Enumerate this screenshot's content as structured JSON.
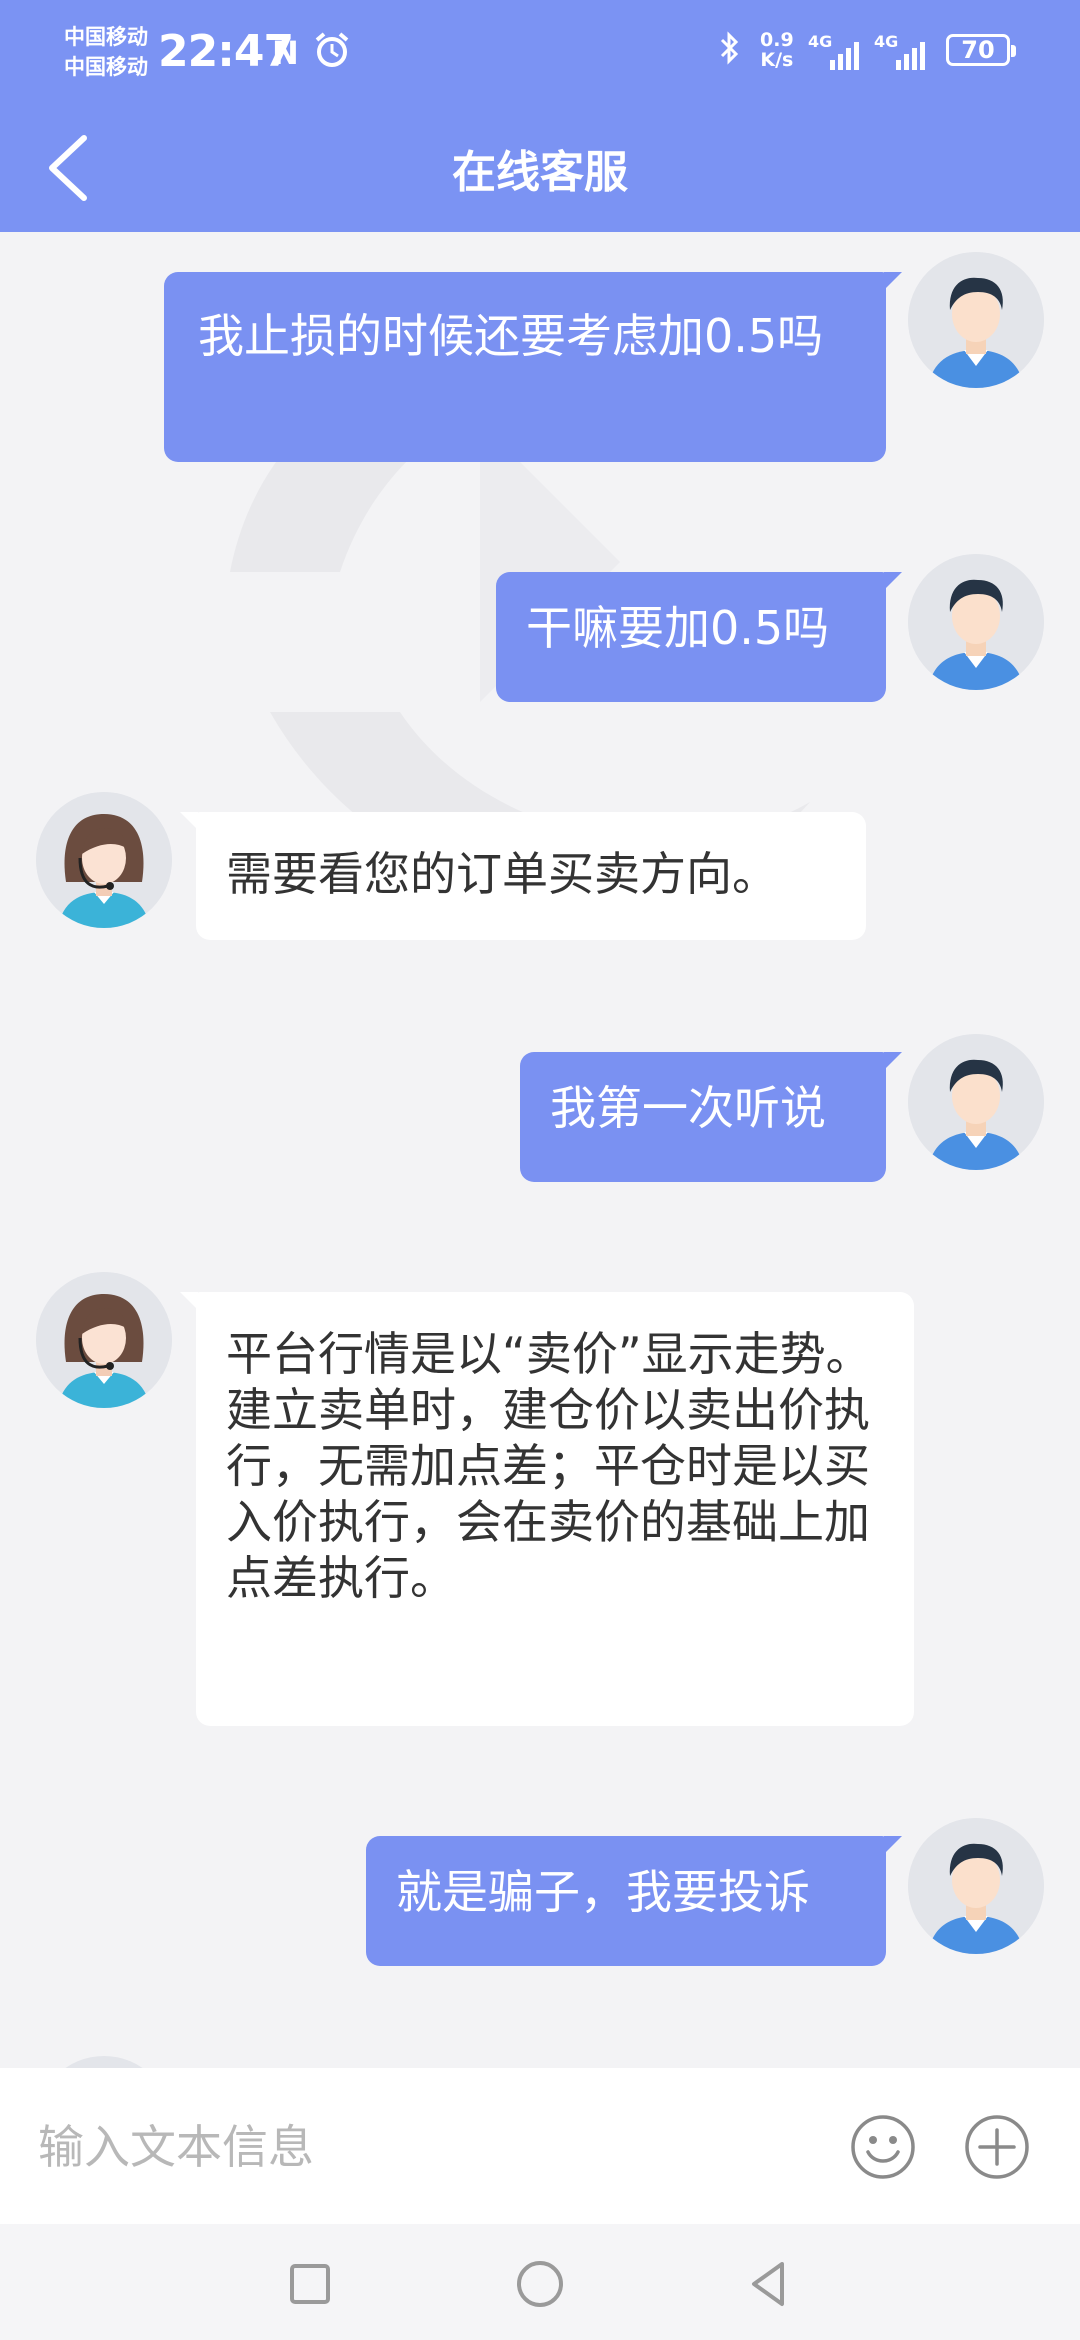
{
  "status_bar": {
    "carrier_1": "中国移动",
    "carrier_2": "中国移动",
    "time": "22:47",
    "nfc": "N",
    "net_speed_value": "0.9",
    "net_speed_unit": "K/s",
    "sim1_network": "4G",
    "sim2_network": "4G",
    "battery": "70"
  },
  "header": {
    "title": "在线客服"
  },
  "messages": [
    {
      "from": "user",
      "text": "我止损的时候还要考虑加0.5吗"
    },
    {
      "from": "user",
      "text": "干嘛要加0.5吗"
    },
    {
      "from": "agent",
      "text": "需要看您的订单买卖方向。"
    },
    {
      "from": "user",
      "text": "我第一次听说"
    },
    {
      "from": "agent",
      "text": "平台行情是以“卖价”显示走势。建立卖单时，建仓价以卖出价执行，无需加点差；平仓时是以买入价执行，会在卖价的基础上加点差执行。"
    },
    {
      "from": "user",
      "text": "就是骗子，我要投诉"
    }
  ],
  "input": {
    "placeholder": "输入文本信息",
    "value": ""
  },
  "icons": {
    "back": "chevron-left-icon",
    "emoji": "smiley-icon",
    "attach": "plus-circle-icon",
    "nav_recent": "square-icon",
    "nav_home": "circle-icon",
    "nav_back": "triangle-left-icon"
  },
  "colors": {
    "header": "#7b93f3",
    "user_bubble": "#7a91f2",
    "agent_bubble": "#ffffff",
    "background": "#f3f3f5"
  }
}
